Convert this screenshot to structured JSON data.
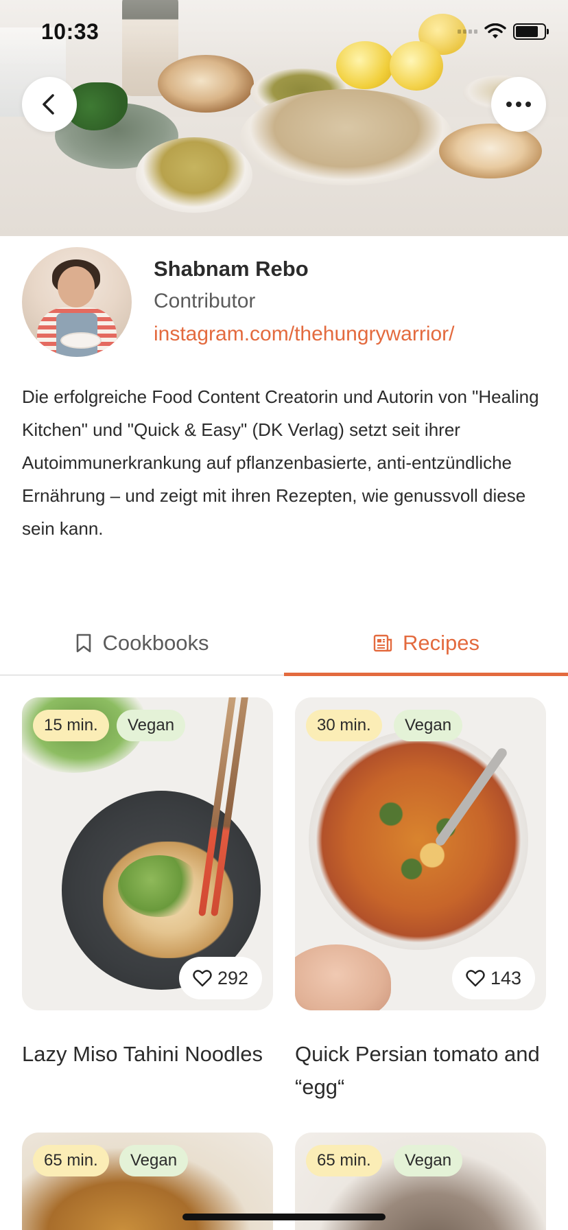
{
  "status_bar": {
    "time": "10:33"
  },
  "hero": {
    "back_icon": "chevron-left-icon",
    "more_icon": "more-horizontal-icon"
  },
  "profile": {
    "name": "Shabnam Rebo",
    "role": "Contributor",
    "link": "instagram.com/thehungrywarrior/",
    "bio": "Die erfolgreiche Food Content Creatorin und Autorin von \"Healing Kitchen\" und \"Quick & Easy\" (DK Verlag) setzt seit ihrer Autoimmunerkrankung auf pflanzenbasierte, anti-entzündliche Ernährung – und  zeigt mit ihren Rezepten, wie genussvoll diese sein kann."
  },
  "tabs": [
    {
      "label": "Cookbooks",
      "icon": "bookmark-icon",
      "active": false
    },
    {
      "label": "Recipes",
      "icon": "newspaper-icon",
      "active": true
    }
  ],
  "recipes": [
    {
      "time": "15 min.",
      "diet": "Vegan",
      "likes": "292",
      "title": "Lazy Miso Tahini Noodles"
    },
    {
      "time": "30 min.",
      "diet": "Vegan",
      "likes": "143",
      "title": "Quick Persian tomato and “egg“"
    },
    {
      "time": "65 min.",
      "diet": "Vegan"
    },
    {
      "time": "65 min.",
      "diet": "Vegan"
    }
  ],
  "colors": {
    "accent": "#e36a3e",
    "time_badge": "#fbedb6",
    "diet_badge": "#e4f2d7",
    "text": "#2b2b2b"
  }
}
